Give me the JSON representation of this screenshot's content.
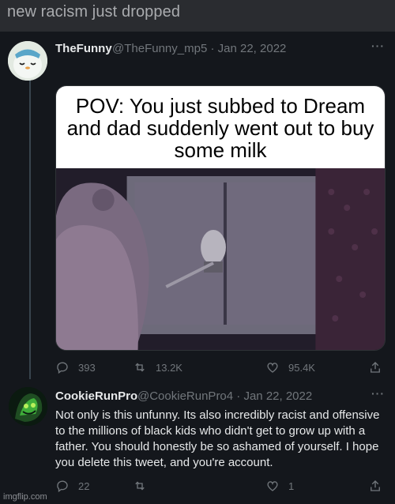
{
  "caption": "new racism just dropped",
  "tweet": {
    "display_name": "TheFunny",
    "handle": "@TheFunny_mp5",
    "separator": "·",
    "date": "Jan 22, 2022",
    "more_label": "···",
    "media_caption": "POV: You just subbed to Dream and dad suddenly went out to buy some milk",
    "stats": {
      "replies": "393",
      "retweets": "13.2K",
      "likes": "95.4K"
    }
  },
  "reply": {
    "display_name": "CookieRunPro",
    "handle": "@CookieRunPro4",
    "separator": "·",
    "date": "Jan 22, 2022",
    "more_label": "···",
    "text": "Not only is this unfunny. Its also incredibly racist and offensive to the millions of black kids who didn't get to grow up with a father. You should honestly be so ashamed of yourself. I hope you delete this tweet, and you're account.",
    "stats": {
      "replies": "22",
      "retweets": "",
      "likes": "1"
    }
  },
  "watermark": "imgflip.com",
  "icons": [
    "reply-icon",
    "retweet-icon",
    "like-icon",
    "share-icon",
    "more-icon"
  ],
  "colors": {
    "background": "#14171c",
    "muted_text": "#71767b",
    "caption_bar": "#2a2c30"
  }
}
